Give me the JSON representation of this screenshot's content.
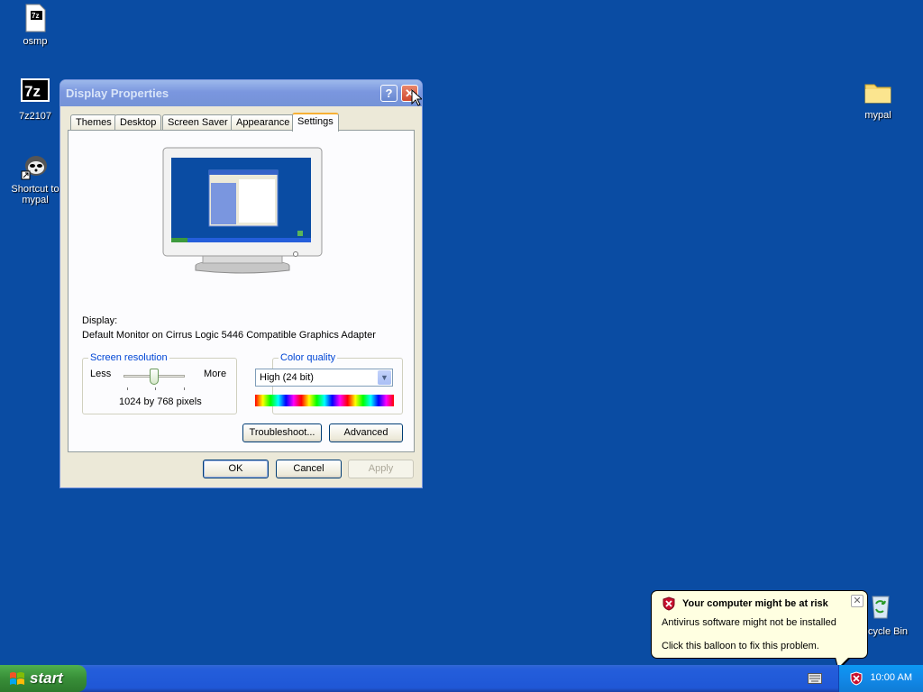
{
  "desktop": {
    "icons": [
      {
        "label": "osmp",
        "icon": "archive-icon"
      },
      {
        "label": "7z2107",
        "icon": "7zip-icon"
      },
      {
        "label": "Shortcut to\nmypal",
        "icon": "raccoon-icon"
      },
      {
        "label": "mypal",
        "icon": "folder-icon"
      },
      {
        "label": "cycle Bin",
        "icon": "recycle-bin-icon"
      }
    ]
  },
  "window": {
    "title": "Display Properties",
    "help_glyph": "?",
    "close_glyph": "✕",
    "tabs": [
      {
        "label": "Themes"
      },
      {
        "label": "Desktop"
      },
      {
        "label": "Screen Saver"
      },
      {
        "label": "Appearance"
      },
      {
        "label": "Settings"
      }
    ],
    "active_tab": "Settings",
    "display_label": "Display:",
    "display_value": "Default Monitor on Cirrus Logic 5446 Compatible Graphics Adapter",
    "resolution": {
      "group_label": "Screen resolution",
      "less": "Less",
      "more": "More",
      "value_text": "1024 by 768 pixels",
      "slider_level": 0.5
    },
    "color_quality": {
      "group_label": "Color quality",
      "selected": "High (24 bit)"
    },
    "buttons": {
      "troubleshoot": "Troubleshoot...",
      "advanced": "Advanced",
      "ok": "OK",
      "cancel": "Cancel",
      "apply": "Apply"
    }
  },
  "taskbar": {
    "start_label": "start",
    "clock": "10:00 AM"
  },
  "balloon": {
    "title": "Your computer might be at risk",
    "line1": "Antivirus software might not be installed",
    "line2": "Click this balloon to fix this problem.",
    "close_glyph": "✕"
  }
}
